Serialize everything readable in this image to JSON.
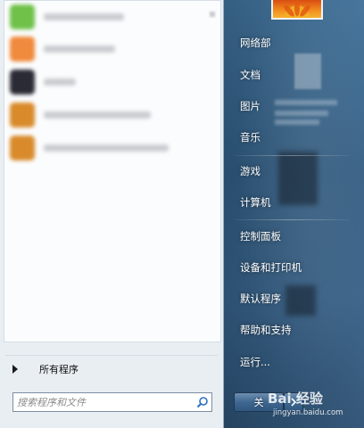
{
  "start_menu": {
    "pinned_programs": [
      {
        "icon": "green-app-icon",
        "color": "#6fc14a"
      },
      {
        "icon": "orange-app-icon",
        "color": "#f08a3c"
      },
      {
        "icon": "dark-app-icon",
        "color": "#2b2b35"
      },
      {
        "icon": "tools-app-icon",
        "color": "#d98b2b"
      },
      {
        "icon": "tools-app-icon",
        "color": "#d98b2b"
      }
    ],
    "all_programs_label": "所有程序",
    "search": {
      "placeholder": "搜索程序和文件"
    },
    "right_items": [
      {
        "label": "网络部"
      },
      {
        "label": "文档"
      },
      {
        "label": "图片"
      },
      {
        "label": "音乐"
      },
      {
        "label": "游戏"
      },
      {
        "label": "计算机"
      },
      {
        "label": "控制面板"
      },
      {
        "label": "设备和打印机"
      },
      {
        "label": "默认程序"
      },
      {
        "label": "帮助和支持"
      },
      {
        "label": "运行..."
      }
    ],
    "shutdown_label": "关",
    "accent_color": "#3f6790"
  },
  "watermark": {
    "main": "Bai 经验",
    "sub": "jingyan.baidu.com"
  }
}
